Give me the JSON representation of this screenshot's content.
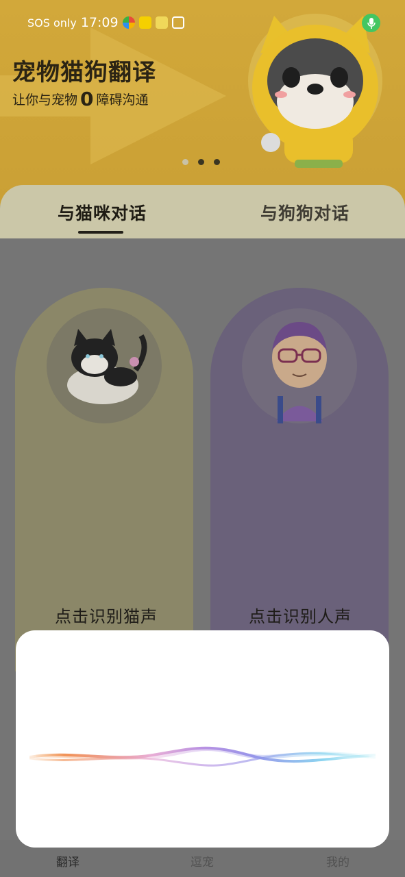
{
  "status_bar": {
    "carrier": "SOS only",
    "time": "17:09"
  },
  "banner": {
    "title": "宠物猫狗翻译",
    "subtitle_prefix": "让你与宠物",
    "subtitle_number": "0",
    "subtitle_suffix": "障碍沟通",
    "dots_count": 3,
    "active_dot_index": 1
  },
  "tabs": [
    {
      "label": "与猫咪对话",
      "active": true
    },
    {
      "label": "与狗狗对话",
      "active": false
    }
  ],
  "cards": {
    "cat": {
      "label": "点击识别猫声"
    },
    "human": {
      "label": "点击识别人声"
    }
  },
  "bottom_nav": [
    {
      "label": "翻译",
      "active": true
    },
    {
      "label": "逗宠",
      "active": false
    },
    {
      "label": "我的",
      "active": false
    }
  ],
  "colors": {
    "banner": "#d2a83a",
    "mic_button": "#43c662",
    "sheet": "#ffffff"
  }
}
